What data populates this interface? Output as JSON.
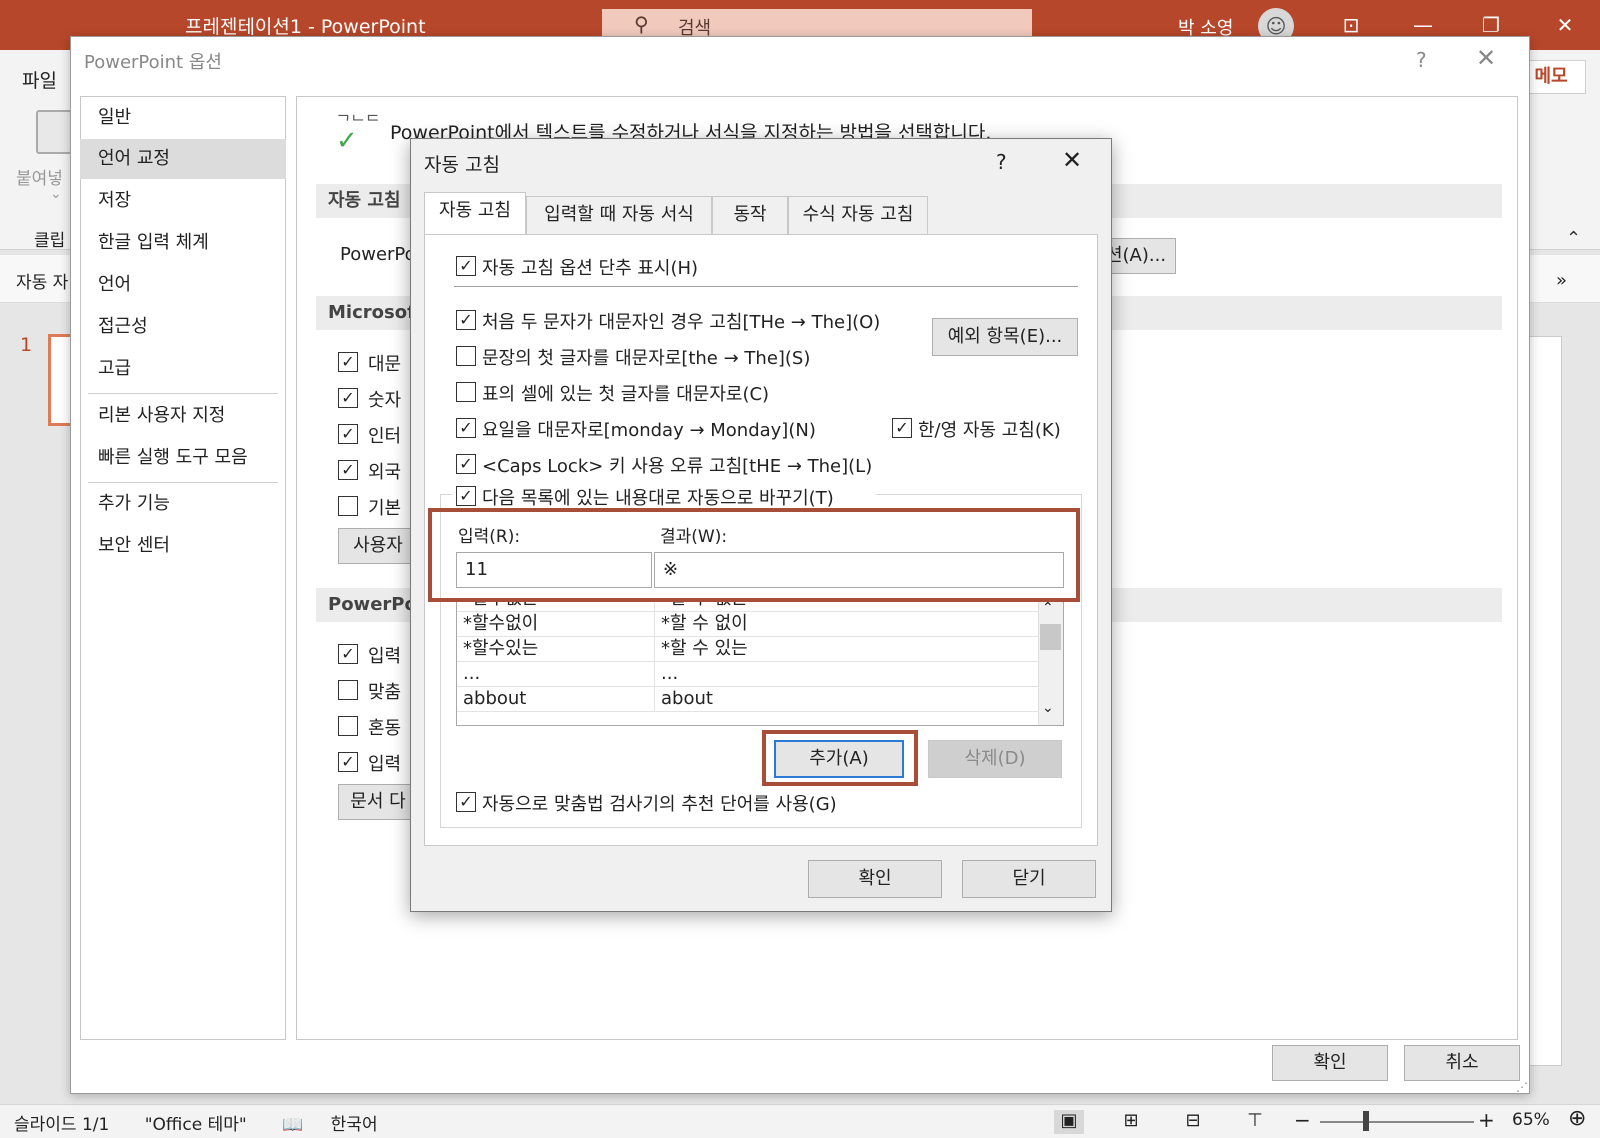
{
  "app": {
    "title": "프레젠테이션1  -  PowerPoint",
    "search_placeholder": "검색",
    "user": "박 소영",
    "win_buttons": [
      "⊡",
      "—",
      "❐",
      "✕"
    ]
  },
  "ribbon": {
    "file_tab": "파일",
    "paste": "붙여넣",
    "paste_arrow": "⌄",
    "clipboard": "클립",
    "memo": "메모",
    "collapse": "⌃",
    "subbar_label": "자동 자",
    "subbar_more": "»"
  },
  "slides": {
    "number": "1"
  },
  "status": {
    "slide": "슬라이드 1/1",
    "theme": "\"Office 테마\"",
    "lang_icon": "📖",
    "language": "한국어",
    "zoom": "65%",
    "minus": "−",
    "plus": "+",
    "fit": "⊕",
    "views": [
      "▣",
      "⊞",
      "⊟",
      "⊤"
    ]
  },
  "options_dialog": {
    "title": "PowerPoint 옵션",
    "help": "?",
    "close": "✕",
    "nav": [
      "일반",
      "언어 교정",
      "저장",
      "한글 입력 체계",
      "언어",
      "접근성",
      "고급",
      "리본 사용자 지정",
      "빠른 실행 도구 모음",
      "추가 기능",
      "보안 센터"
    ],
    "abc": "ᄀᄂᄃ",
    "check": "✓",
    "description": "PowerPoint에서 텍스트를 수정하거나 서식을 지정하는 방법을 선택합니다.",
    "sec_autocorrect": "자동 고침",
    "autocorrect_text": "PowerPo",
    "autocorrect_btn": "션(A)...",
    "sec_microsoft": "Microsoft",
    "ms_items": [
      "대문",
      "숫자",
      "인터",
      "외국",
      "기본"
    ],
    "custom_btn": "사용자",
    "sec_powerpoint": "PowerPoi",
    "pp_items": [
      "입력",
      "맞춤",
      "혼동",
      "입력"
    ],
    "doc_btn": "문서 다",
    "ok": "확인",
    "cancel": "취소",
    "grip": "⋰"
  },
  "autocorrect": {
    "title": "자동 고침",
    "help": "?",
    "close": "✕",
    "tabs": [
      "자동 고침",
      "입력할 때 자동 서식",
      "동작",
      "수식 자동 고침"
    ],
    "show_buttons": "자동 고침 옵션 단추 표시(H)",
    "two_initial": "처음 두 문자가 대문자인 경우 고침[THe → The](O)",
    "sentence_cap": "문장의 첫 글자를 대문자로[the → The](S)",
    "table_cap": "표의 셀에 있는 첫 글자를 대문자로(C)",
    "day_cap": "요일을 대문자로[monday → Monday](N)",
    "hanyoung": "한/영 자동 고침(K)",
    "caps_lock": "<Caps Lock> 키 사용 오류 고침[tHE → The](L)",
    "replace": "다음 목록에 있는 내용대로 자동으로 바꾸기(T)",
    "exceptions": "예외 항목(E)...",
    "input_label": "입력(R):",
    "result_label": "결과(W):",
    "input_value": "11",
    "result_value": "※",
    "rows": [
      {
        "in": "*할수없는",
        "out": "*할 수 없는"
      },
      {
        "in": "*할수없이",
        "out": "*할 수 없이"
      },
      {
        "in": "*할수있는",
        "out": "*할 수 있는"
      },
      {
        "in": "...",
        "out": "..."
      },
      {
        "in": "abbout",
        "out": "about"
      }
    ],
    "scroll_up": "⌃",
    "scroll_down": "⌄",
    "add": "추가(A)",
    "delete": "삭제(D)",
    "spell_suggest": "자동으로 맞춤법 검사기의 추천 단어를 사용(G)",
    "ok": "확인",
    "close_btn": "닫기",
    "check_mark": "✓"
  }
}
